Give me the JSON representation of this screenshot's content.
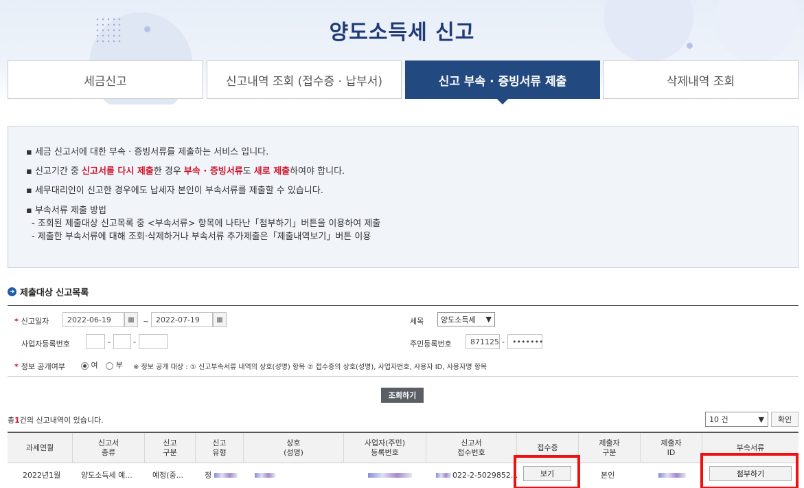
{
  "header": {
    "title": "양도소득세  신고"
  },
  "tabs": [
    {
      "label": "세금신고"
    },
    {
      "label": "신고내역 조회 (접수증 · 납부서)"
    },
    {
      "label": "신고 부속 · 증빙서류 제출"
    },
    {
      "label": "삭제내역 조회"
    }
  ],
  "info": {
    "line1": "세금 신고서에 대한 부속 · 증빙서류를 제출하는 서비스 입니다.",
    "line2_a": "신고기간 중 ",
    "line2_b": "신고서를 다시 제출",
    "line2_c": "한 경우 ",
    "line2_d": "부속 · 증빙서류",
    "line2_e": "도 ",
    "line2_f": "새로 제출",
    "line2_g": "하여야 합니다.",
    "line3": "세무대리인이 신고한 경우에도 납세자 본인이 부속서류를 제출할 수 있습니다.",
    "line4": "부속서류 제출 방법",
    "line4_sub1": "- 조회된 제출대상 신고목록 중 <부속서류> 항목에 나타난「첨부하기」버튼을 이용하여 제출",
    "line4_sub2": "- 제출한 부속서류에 대해 조회·삭제하거나 부속서류 추가제출은「제출내역보기」버튼 이용"
  },
  "section": {
    "title": "제출대상 신고목록",
    "icon": "arrow-right-circle-icon"
  },
  "form": {
    "date_label": "신고일자",
    "date_from": "2022-06-19",
    "date_to": "2022-07-19",
    "tilde": "~",
    "tax_label": "세목",
    "tax_value": "양도소득세",
    "bizno_label": "사업자등록번호",
    "dash": "-",
    "rrn_label": "주민등록번호",
    "rrn_front": "871125",
    "rrn_back": "•••••••",
    "public_label": "정보 공개여부",
    "opt_yes": "여",
    "opt_no": "부",
    "public_note": "※ 정보 공개 대상 : ① 신고부속서류 내역의 상호(성명) 항목 ② 접수증의 상호(성명), 사업자번호, 사용자 ID, 사용자명 항목",
    "search_button": "조회하기"
  },
  "result": {
    "count_prefix": "총",
    "count_value": "1",
    "count_suffix": "건의 신고내역이 있습니다.",
    "page_size": "10 건",
    "ok_button": "확인"
  },
  "table": {
    "headers": [
      {
        "l1": "과세연월",
        "l2": ""
      },
      {
        "l1": "신고서",
        "l2": "종류"
      },
      {
        "l1": "신고",
        "l2": "구분"
      },
      {
        "l1": "신고",
        "l2": "유형"
      },
      {
        "l1": "상호",
        "l2": "(성명)"
      },
      {
        "l1": "사업자(주민)",
        "l2": "등록번호"
      },
      {
        "l1": "신고서",
        "l2": "접수번호"
      },
      {
        "l1": "접수증",
        "l2": ""
      },
      {
        "l1": "제출자",
        "l2": "구분"
      },
      {
        "l1": "제출자",
        "l2": "ID"
      },
      {
        "l1": "부속서류",
        "l2": ""
      }
    ],
    "row": {
      "period": "2022년1월",
      "form_type": "양도소득세 예...",
      "report_type": "예정(중...",
      "kind": "정",
      "receipt_no": "022-2-5029852...",
      "view_button": "보기",
      "submitter_type": "본인",
      "attach_button": "첨부하기"
    }
  }
}
